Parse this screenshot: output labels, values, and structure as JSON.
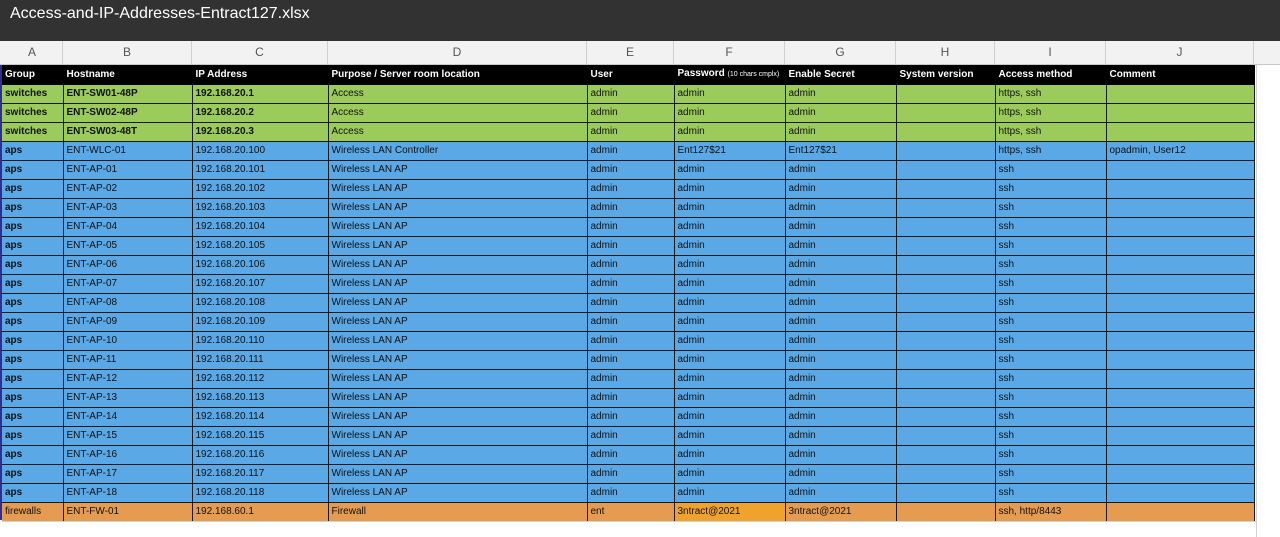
{
  "window": {
    "title": "Access-and-IP-Addresses-Entract127.xlsx"
  },
  "columns": [
    "A",
    "B",
    "C",
    "D",
    "E",
    "F",
    "G",
    "H",
    "I",
    "J"
  ],
  "header": {
    "group": "Group",
    "hostname": "Hostname",
    "ip": "IP Address",
    "purpose": "Purpose / Server room location",
    "user": "User",
    "password": "Password",
    "password_note": "(10 chars cmplx)",
    "enable_secret": "Enable Secret",
    "system_version": "System version",
    "access_method": "Access method",
    "comment": "Comment"
  },
  "rows": [
    {
      "group": "switches",
      "hostname": "ENT-SW01-48P",
      "ip": "192.168.20.1",
      "purpose": "Access",
      "user": "admin",
      "password": "admin",
      "enable_secret": "admin",
      "system_version": "",
      "access_method": "https, ssh",
      "comment": ""
    },
    {
      "group": "switches",
      "hostname": "ENT-SW02-48P",
      "ip": "192.168.20.2",
      "purpose": "Access",
      "user": "admin",
      "password": "admin",
      "enable_secret": "admin",
      "system_version": "",
      "access_method": "https, ssh",
      "comment": ""
    },
    {
      "group": "switches",
      "hostname": "ENT-SW03-48T",
      "ip": "192.168.20.3",
      "purpose": "Access",
      "user": "admin",
      "password": "admin",
      "enable_secret": "admin",
      "system_version": "",
      "access_method": "https, ssh",
      "comment": ""
    },
    {
      "group": "aps",
      "hostname": "ENT-WLC-01",
      "ip": "192.168.20.100",
      "purpose": "Wireless LAN Controller",
      "user": "admin",
      "password": "Ent127$21",
      "enable_secret": "Ent127$21",
      "system_version": "",
      "access_method": "https, ssh",
      "comment": "opadmin, User12"
    },
    {
      "group": "aps",
      "hostname": "ENT-AP-01",
      "ip": "192.168.20.101",
      "purpose": "Wireless LAN AP",
      "user": "admin",
      "password": "admin",
      "enable_secret": "admin",
      "system_version": "",
      "access_method": "ssh",
      "comment": ""
    },
    {
      "group": "aps",
      "hostname": "ENT-AP-02",
      "ip": "192.168.20.102",
      "purpose": "Wireless LAN AP",
      "user": "admin",
      "password": "admin",
      "enable_secret": "admin",
      "system_version": "",
      "access_method": "ssh",
      "comment": ""
    },
    {
      "group": "aps",
      "hostname": "ENT-AP-03",
      "ip": "192.168.20.103",
      "purpose": "Wireless LAN AP",
      "user": "admin",
      "password": "admin",
      "enable_secret": "admin",
      "system_version": "",
      "access_method": "ssh",
      "comment": ""
    },
    {
      "group": "aps",
      "hostname": "ENT-AP-04",
      "ip": "192.168.20.104",
      "purpose": "Wireless LAN AP",
      "user": "admin",
      "password": "admin",
      "enable_secret": "admin",
      "system_version": "",
      "access_method": "ssh",
      "comment": ""
    },
    {
      "group": "aps",
      "hostname": "ENT-AP-05",
      "ip": "192.168.20.105",
      "purpose": "Wireless LAN AP",
      "user": "admin",
      "password": "admin",
      "enable_secret": "admin",
      "system_version": "",
      "access_method": "ssh",
      "comment": ""
    },
    {
      "group": "aps",
      "hostname": "ENT-AP-06",
      "ip": "192.168.20.106",
      "purpose": "Wireless LAN AP",
      "user": "admin",
      "password": "admin",
      "enable_secret": "admin",
      "system_version": "",
      "access_method": "ssh",
      "comment": ""
    },
    {
      "group": "aps",
      "hostname": "ENT-AP-07",
      "ip": "192.168.20.107",
      "purpose": "Wireless LAN AP",
      "user": "admin",
      "password": "admin",
      "enable_secret": "admin",
      "system_version": "",
      "access_method": "ssh",
      "comment": ""
    },
    {
      "group": "aps",
      "hostname": "ENT-AP-08",
      "ip": "192.168.20.108",
      "purpose": "Wireless LAN AP",
      "user": "admin",
      "password": "admin",
      "enable_secret": "admin",
      "system_version": "",
      "access_method": "ssh",
      "comment": ""
    },
    {
      "group": "aps",
      "hostname": "ENT-AP-09",
      "ip": "192.168.20.109",
      "purpose": "Wireless LAN AP",
      "user": "admin",
      "password": "admin",
      "enable_secret": "admin",
      "system_version": "",
      "access_method": "ssh",
      "comment": ""
    },
    {
      "group": "aps",
      "hostname": "ENT-AP-10",
      "ip": "192.168.20.110",
      "purpose": "Wireless LAN AP",
      "user": "admin",
      "password": "admin",
      "enable_secret": "admin",
      "system_version": "",
      "access_method": "ssh",
      "comment": ""
    },
    {
      "group": "aps",
      "hostname": "ENT-AP-11",
      "ip": "192.168.20.111",
      "purpose": "Wireless LAN AP",
      "user": "admin",
      "password": "admin",
      "enable_secret": "admin",
      "system_version": "",
      "access_method": "ssh",
      "comment": ""
    },
    {
      "group": "aps",
      "hostname": "ENT-AP-12",
      "ip": "192.168.20.112",
      "purpose": "Wireless LAN AP",
      "user": "admin",
      "password": "admin",
      "enable_secret": "admin",
      "system_version": "",
      "access_method": "ssh",
      "comment": ""
    },
    {
      "group": "aps",
      "hostname": "ENT-AP-13",
      "ip": "192.168.20.113",
      "purpose": "Wireless LAN AP",
      "user": "admin",
      "password": "admin",
      "enable_secret": "admin",
      "system_version": "",
      "access_method": "ssh",
      "comment": ""
    },
    {
      "group": "aps",
      "hostname": "ENT-AP-14",
      "ip": "192.168.20.114",
      "purpose": "Wireless LAN AP",
      "user": "admin",
      "password": "admin",
      "enable_secret": "admin",
      "system_version": "",
      "access_method": "ssh",
      "comment": ""
    },
    {
      "group": "aps",
      "hostname": "ENT-AP-15",
      "ip": "192.168.20.115",
      "purpose": "Wireless LAN AP",
      "user": "admin",
      "password": "admin",
      "enable_secret": "admin",
      "system_version": "",
      "access_method": "ssh",
      "comment": ""
    },
    {
      "group": "aps",
      "hostname": "ENT-AP-16",
      "ip": "192.168.20.116",
      "purpose": "Wireless LAN AP",
      "user": "admin",
      "password": "admin",
      "enable_secret": "admin",
      "system_version": "",
      "access_method": "ssh",
      "comment": ""
    },
    {
      "group": "aps",
      "hostname": "ENT-AP-17",
      "ip": "192.168.20.117",
      "purpose": "Wireless LAN AP",
      "user": "admin",
      "password": "admin",
      "enable_secret": "admin",
      "system_version": "",
      "access_method": "ssh",
      "comment": ""
    },
    {
      "group": "aps",
      "hostname": "ENT-AP-18",
      "ip": "192.168.20.118",
      "purpose": "Wireless LAN AP",
      "user": "admin",
      "password": "admin",
      "enable_secret": "admin",
      "system_version": "",
      "access_method": "ssh",
      "comment": ""
    },
    {
      "group": "firewalls",
      "hostname": "ENT-FW-01",
      "ip": "192.168.60.1",
      "purpose": "Firewall",
      "user": "ent",
      "password": "3ntract@2021",
      "enable_secret": "3ntract@2021",
      "system_version": "",
      "access_method": "ssh, http/8443",
      "comment": ""
    }
  ],
  "colors": {
    "switches": "#9bcb5b",
    "aps": "#5aa8e6",
    "firewalls": "#e59c50",
    "header": "#000000",
    "titlebar": "#323232"
  }
}
